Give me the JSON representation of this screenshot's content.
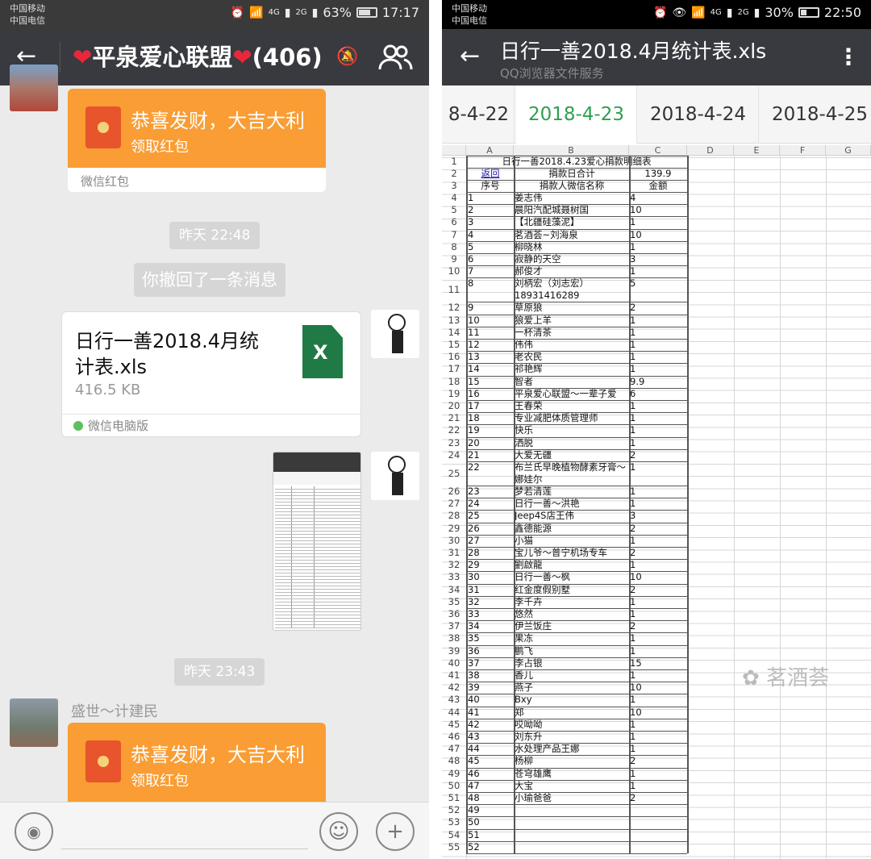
{
  "left": {
    "status": {
      "carrier1": "中国移动",
      "carrier2": "中国电信",
      "battery": "63%",
      "time": "17:17",
      "net1": "4G",
      "net2": "2G"
    },
    "header": {
      "title": "平泉爱心联盟",
      "count": "(406)",
      "mute_icon": "bell-off-icon",
      "members_icon": "people-icon"
    },
    "redpacket1": {
      "title": "恭喜发财，大吉大利",
      "action": "领取红包",
      "footer": "微信红包"
    },
    "ts1": "昨天 22:48",
    "recall": "你撤回了一条消息",
    "file": {
      "name": "日行一善2018.4月统计表.xls",
      "size": "416.5 KB",
      "source": "微信电脑版",
      "icon_letter": "X"
    },
    "ts2": "昨天 23:43",
    "sender": "盛世～计建民",
    "redpacket2": {
      "title": "恭喜发财，大吉大利",
      "action": "领取红包"
    },
    "input": {
      "voice_icon": "voice-icon",
      "emoji_icon": "emoji-icon",
      "plus_icon": "plus-icon"
    }
  },
  "right": {
    "status": {
      "carrier1": "中国移动",
      "carrier2": "中国电信",
      "battery": "30%",
      "time": "22:50",
      "net1": "4G",
      "net2": "2G"
    },
    "header": {
      "title": "日行一善2018.4月统计表.xls",
      "subtitle": "QQ浏览器文件服务",
      "menu_icon": "more-vert-icon"
    },
    "tabs": [
      "8-4-22",
      "2018-4-23",
      "2018-4-24",
      "2018-4-25"
    ],
    "active_tab": "2018-4-23",
    "cols": [
      "A",
      "B",
      "C",
      "D",
      "E",
      "F",
      "G"
    ],
    "sheet": {
      "title": "日行一善2018.4.23爱心捐款明细表",
      "r2": {
        "a": "返回",
        "b": "捐款日合计",
        "c": "139.9"
      },
      "r3": {
        "a": "序号",
        "b": "捐款人微信名称",
        "c": "金额"
      },
      "rows": [
        {
          "n": "4",
          "a": "1",
          "b": "姜志伟",
          "c": "4"
        },
        {
          "n": "5",
          "a": "2",
          "b": "晨阳汽配城聂树国",
          "c": "10"
        },
        {
          "n": "6",
          "a": "3",
          "b": "【北疆硅藻泥】",
          "c": "1"
        },
        {
          "n": "7",
          "a": "4",
          "b": "茗酒荟~刘海泉",
          "c": "10"
        },
        {
          "n": "8",
          "a": "5",
          "b": "柳晓林",
          "c": "1"
        },
        {
          "n": "9",
          "a": "6",
          "b": "寂静的天空",
          "c": "3"
        },
        {
          "n": "10",
          "a": "7",
          "b": "郝俊才",
          "c": "1"
        },
        {
          "n": "11",
          "a": "8",
          "b": "刘柄宏（刘志宏）18931416289",
          "c": "5",
          "tall": true
        },
        {
          "n": "12",
          "a": "9",
          "b": "草原狼",
          "c": "2"
        },
        {
          "n": "13",
          "a": "10",
          "b": "狼爱上羊",
          "c": "1"
        },
        {
          "n": "14",
          "a": "11",
          "b": "一杯清茶",
          "c": "1"
        },
        {
          "n": "15",
          "a": "12",
          "b": "伟伟",
          "c": "1"
        },
        {
          "n": "16",
          "a": "13",
          "b": "老农民",
          "c": "1"
        },
        {
          "n": "17",
          "a": "14",
          "b": "祁艳辉",
          "c": "1"
        },
        {
          "n": "18",
          "a": "15",
          "b": "智者",
          "c": "9.9"
        },
        {
          "n": "19",
          "a": "16",
          "b": "平泉爱心联盟～一辈子爱",
          "c": "6"
        },
        {
          "n": "20",
          "a": "17",
          "b": "王春荣",
          "c": "1"
        },
        {
          "n": "21",
          "a": "18",
          "b": "专业减肥体质管理师",
          "c": "1"
        },
        {
          "n": "22",
          "a": "19",
          "b": "快乐",
          "c": "1"
        },
        {
          "n": "23",
          "a": "20",
          "b": "洒脱",
          "c": "1"
        },
        {
          "n": "24",
          "a": "21",
          "b": "大爱无疆",
          "c": "2"
        },
        {
          "n": "25",
          "a": "22",
          "b": "布兰氏早晚植物酵素牙膏～娜娃尔",
          "c": "1",
          "tall": true
        },
        {
          "n": "26",
          "a": "23",
          "b": "梦若清莲",
          "c": "1"
        },
        {
          "n": "27",
          "a": "24",
          "b": "日行一善～洪艳",
          "c": "1"
        },
        {
          "n": "28",
          "a": "25",
          "b": "Jeep4S店王伟",
          "c": "3"
        },
        {
          "n": "29",
          "a": "26",
          "b": "鑫德能源",
          "c": "2"
        },
        {
          "n": "30",
          "a": "27",
          "b": "小猫",
          "c": "1"
        },
        {
          "n": "31",
          "a": "28",
          "b": "宝儿爷～普宁机场专车",
          "c": "2"
        },
        {
          "n": "32",
          "a": "29",
          "b": "劉啟龍",
          "c": "1"
        },
        {
          "n": "33",
          "a": "30",
          "b": "日行一善～枫",
          "c": "10"
        },
        {
          "n": "34",
          "a": "31",
          "b": "红金度假别墅",
          "c": "2"
        },
        {
          "n": "35",
          "a": "32",
          "b": "李千卉",
          "c": "1"
        },
        {
          "n": "36",
          "a": "33",
          "b": "悠然",
          "c": "1"
        },
        {
          "n": "37",
          "a": "34",
          "b": "伊兰饭庄",
          "c": "2"
        },
        {
          "n": "38",
          "a": "35",
          "b": "果冻",
          "c": "1"
        },
        {
          "n": "39",
          "a": "36",
          "b": "鹏飞",
          "c": "1"
        },
        {
          "n": "40",
          "a": "37",
          "b": "李占银",
          "c": "15"
        },
        {
          "n": "41",
          "a": "38",
          "b": "香儿",
          "c": "1"
        },
        {
          "n": "42",
          "a": "39",
          "b": "燕子",
          "c": "10"
        },
        {
          "n": "43",
          "a": "40",
          "b": "Bxy",
          "c": "1"
        },
        {
          "n": "44",
          "a": "41",
          "b": "郑",
          "c": "10"
        },
        {
          "n": "45",
          "a": "42",
          "b": "哎呦呦",
          "c": "1"
        },
        {
          "n": "46",
          "a": "43",
          "b": "刘东升",
          "c": "1"
        },
        {
          "n": "47",
          "a": "44",
          "b": "水处理产品王娜",
          "c": "1"
        },
        {
          "n": "48",
          "a": "45",
          "b": "杨柳",
          "c": "2"
        },
        {
          "n": "49",
          "a": "46",
          "b": "苍穹雄鹰",
          "c": "1"
        },
        {
          "n": "50",
          "a": "47",
          "b": "大宝",
          "c": "1"
        },
        {
          "n": "51",
          "a": "48",
          "b": "小瑜爸爸",
          "c": "2"
        },
        {
          "n": "52",
          "a": "49",
          "b": "",
          "c": ""
        },
        {
          "n": "53",
          "a": "50",
          "b": "",
          "c": ""
        },
        {
          "n": "54",
          "a": "51",
          "b": "",
          "c": ""
        },
        {
          "n": "55",
          "a": "52",
          "b": "",
          "c": ""
        }
      ]
    },
    "watermark": "茗酒荟"
  }
}
